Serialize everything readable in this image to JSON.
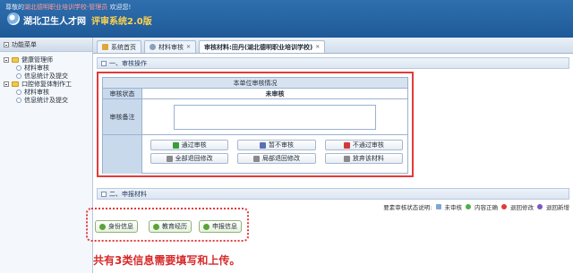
{
  "header": {
    "welcome_prefix": "尊敬的",
    "welcome_org": "湖北德明职业培训学校",
    "welcome_role": "管理员",
    "welcome_suffix": " 欢迎您!",
    "brand_title": "湖北卫生人才网",
    "brand_subtitle": "评审系统2.0版"
  },
  "sidebar": {
    "title": "功能菜单",
    "tree": [
      {
        "label": "健康管理师",
        "children": [
          "材料审核",
          "信息统计及提交"
        ]
      },
      {
        "label": "口腔修复体制作工",
        "children": [
          "材料审核",
          "信息统计及提交"
        ]
      }
    ]
  },
  "tabs": [
    {
      "label": "系统首页"
    },
    {
      "label": "材料审核"
    },
    {
      "label": "审核材料:田丹(湖北德明职业培训学校)"
    }
  ],
  "review": {
    "section_title": "一、审核操作",
    "table_caption": "本单位审核情况",
    "status_label": "审核状态",
    "status_value": "未审核",
    "remark_label": "审核备注",
    "remark_value": "",
    "buttons": [
      {
        "label": "通过审核",
        "icon": "check-icon",
        "color": "#3a9c3a"
      },
      {
        "label": "暂不审核",
        "icon": "pause-icon",
        "color": "#5a6fb5"
      },
      {
        "label": "不通过审核",
        "icon": "cross-icon",
        "color": "#d23a3a"
      },
      {
        "label": "全部退回修改",
        "icon": "return-icon",
        "color": "#8a8a8a"
      },
      {
        "label": "局部退回修改",
        "icon": "partial-return-icon",
        "color": "#8a8a8a"
      },
      {
        "label": "放弃该材料",
        "icon": "discard-icon",
        "color": "#8a8a8a"
      }
    ]
  },
  "materials": {
    "section_title": "二、申报材料",
    "legend_title": "要素审核状态说明:",
    "legend": [
      {
        "label": "未审核",
        "color": "#7ea6d8"
      },
      {
        "label": "内容正确",
        "color": "#4caf50"
      },
      {
        "label": "退回修改",
        "color": "#e53935"
      },
      {
        "label": "退回新增",
        "color": "#7e57c2"
      }
    ],
    "info_buttons": [
      {
        "label": "身份信息"
      },
      {
        "label": "教育经历"
      },
      {
        "label": "申报信息"
      }
    ],
    "caption": "共有3类信息需要填写和上传。"
  }
}
